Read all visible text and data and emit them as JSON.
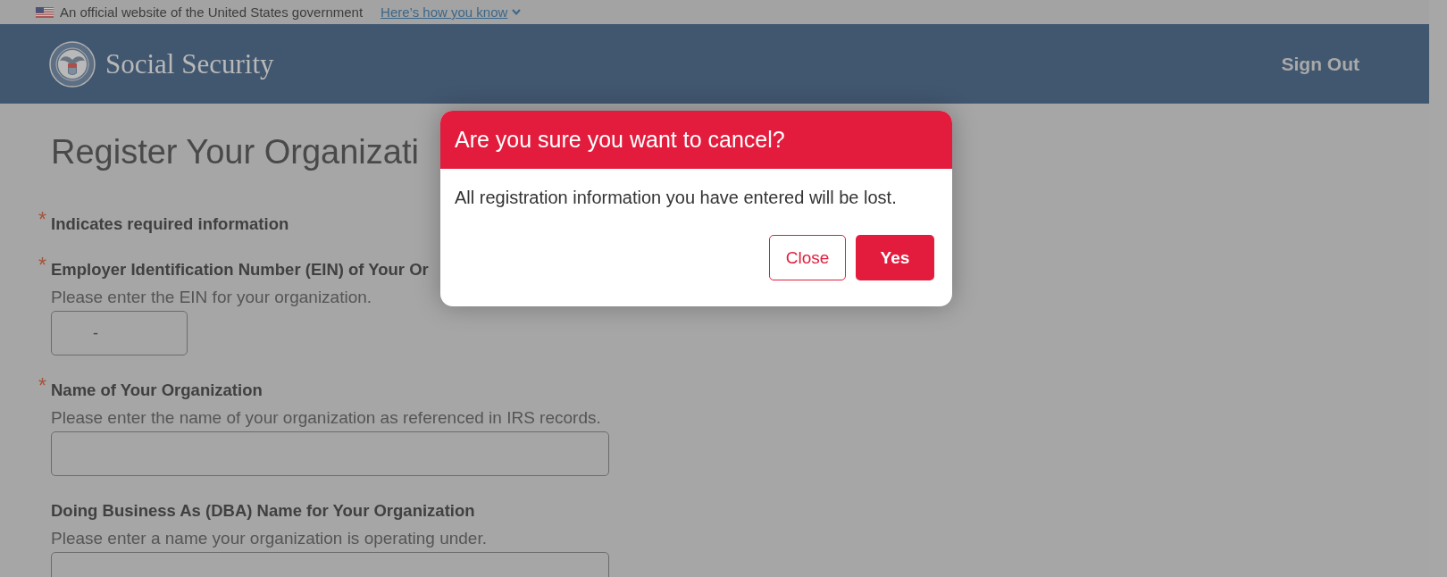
{
  "gov_banner": {
    "text": "An official website of the United States government",
    "link": "Here’s how you know"
  },
  "header": {
    "site_name": "Social Security",
    "sign_out": "Sign Out"
  },
  "form": {
    "title": "Register Your Organizati",
    "required_note": {
      "marker": "*",
      "text": "Indicates required information"
    },
    "fields": [
      {
        "marker": "*",
        "label": "Employer Identification Number (EIN) of Your Or",
        "help": "Please enter the EIN for your organization.",
        "kind": "short",
        "value": "-"
      },
      {
        "marker": "*",
        "label": "Name of Your Organization",
        "help": "Please enter the name of your organization as referenced in IRS records.",
        "kind": "full"
      },
      {
        "label": "Doing Business As (DBA) Name for Your Organization",
        "help": "Please enter a name your organization is operating under.",
        "kind": "full"
      }
    ]
  },
  "dialog": {
    "title": "Are you sure you want to cancel?",
    "message": "All registration information you have entered will be lost.",
    "buttons": [
      {
        "label": "Close",
        "kind": "outline"
      },
      {
        "label": "Yes",
        "kind": "primary"
      }
    ]
  }
}
